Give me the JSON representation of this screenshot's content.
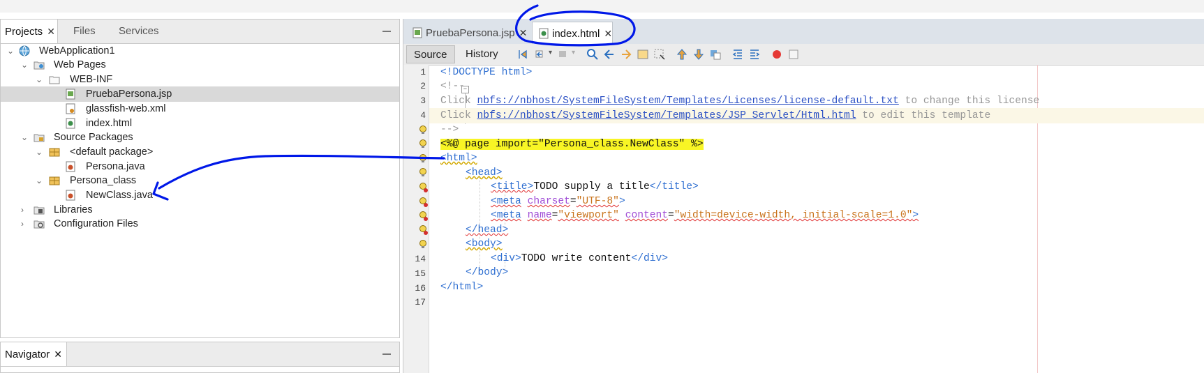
{
  "projects_panel": {
    "tabs": [
      {
        "label": "Projects",
        "close": "✕"
      },
      {
        "label": "Files"
      },
      {
        "label": "Services"
      }
    ],
    "tree": [
      {
        "label": "WebApplication1",
        "icon": "globe-icon",
        "expanded": true
      },
      {
        "label": "Web Pages",
        "icon": "web-folder-icon",
        "expanded": true
      },
      {
        "label": "WEB-INF",
        "icon": "folder-icon",
        "expanded": true
      },
      {
        "label": "PruebaPersona.jsp",
        "icon": "jsp-file-icon",
        "selected": true
      },
      {
        "label": "glassfish-web.xml",
        "icon": "xml-file-icon"
      },
      {
        "label": "index.html",
        "icon": "html-file-icon"
      },
      {
        "label": "Source Packages",
        "icon": "package-folder-icon",
        "expanded": true
      },
      {
        "label": "<default package>",
        "icon": "package-icon",
        "expanded": true
      },
      {
        "label": "Persona.java",
        "icon": "java-file-icon"
      },
      {
        "label": "Persona_class",
        "icon": "package-icon",
        "expanded": true
      },
      {
        "label": "NewClass.java",
        "icon": "java-file-icon"
      },
      {
        "label": "Libraries",
        "icon": "library-icon",
        "expanded": false
      },
      {
        "label": "Configuration Files",
        "icon": "config-icon",
        "expanded": false
      }
    ]
  },
  "navigator": {
    "label": "Navigator",
    "close": "✕"
  },
  "editor": {
    "tabs": [
      {
        "label": "PruebaPersona.jsp",
        "close": "✕"
      },
      {
        "label": "index.html",
        "close": "✕",
        "active": true
      }
    ],
    "source_label": "Source",
    "history_label": "History",
    "line_numbers": [
      "1",
      "2",
      "3",
      "4",
      "",
      "",
      "",
      "",
      "",
      "",
      "",
      "",
      "",
      "14",
      "15",
      "16",
      "17"
    ],
    "lines": {
      "l1": "<!DOCTYPE html>",
      "l2": "<!--",
      "l3_pre": "Click ",
      "l3_link": "nbfs://nbhost/SystemFileSystem/Templates/Licenses/license-default.txt",
      "l3_post": " to change this license",
      "l4_pre": "Click ",
      "l4_link": "nbfs://nbhost/SystemFileSystem/Templates/JSP_Servlet/Html.html",
      "l4_post": " to edit this template",
      "l5": "-->",
      "l6": "<%@ page import=\"Persona_class.NewClass\" %>",
      "l7": "<html>",
      "l8": "<head>",
      "l9_open": "<title>",
      "l9_text": "TODO supply a title",
      "l9_close": "</title>",
      "l10_tag": "<meta",
      "l10_attr": "charset",
      "l10_eq": "=",
      "l10_val": "\"UTF-8\"",
      "l10_end": ">",
      "l11_tag": "<meta",
      "l11_attr1": "name",
      "l11_val1": "\"viewport\"",
      "l11_attr2": "content",
      "l11_val2": "\"width=device-width, initial-scale=1.0\"",
      "l11_end": ">",
      "l12": "</head>",
      "l13": "<body>",
      "l14_open": "<div>",
      "l14_text": "TODO write content",
      "l14_close": "</div>",
      "l15": "</body>",
      "l16": "</html>"
    }
  },
  "colors": {
    "annotation": "#0018e8",
    "highlight": "#f8f525",
    "tag": "#2f6fd1",
    "comment": "#969696"
  }
}
